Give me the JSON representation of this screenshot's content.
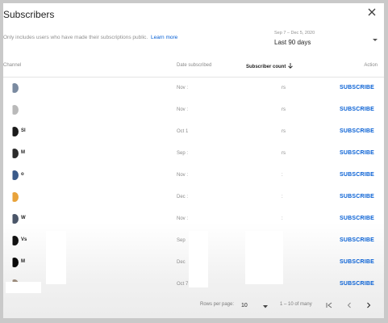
{
  "dialog": {
    "title": "Subscribers",
    "info_text": "Only includes users who have made their subscriptions public.",
    "learn_more": "Learn more",
    "date_range": "Sep 7 – Dec 5, 2020",
    "date_selection": "Last 90 days"
  },
  "table": {
    "columns": {
      "channel": "Channel",
      "date_subscribed": "Date subscribed",
      "subscriber_count": "Subscriber count",
      "action": "Action"
    },
    "rows": [
      {
        "mark": "",
        "date": "Nov :",
        "count": "rs",
        "avatar_color": "#7a8aa0",
        "action": "SUBSCRIBE"
      },
      {
        "mark": "",
        "date": "Nov :",
        "count": "rs",
        "avatar_color": "#b9b9b9",
        "action": "SUBSCRIBE"
      },
      {
        "mark": "Sl",
        "date": "Oct 1",
        "count": "rs",
        "avatar_color": "#1b1b1b",
        "action": "SUBSCRIBE"
      },
      {
        "mark": "M",
        "date": "Sep :",
        "count": "rs",
        "avatar_color": "#2c2c2c",
        "action": "SUBSCRIBE"
      },
      {
        "mark": "o",
        "date": "Nov :",
        "count": ":",
        "avatar_color": "#3a5a8a",
        "action": "SUBSCRIBE"
      },
      {
        "mark": "",
        "date": "Dec :",
        "count": ":",
        "avatar_color": "#e8a23a",
        "action": "SUBSCRIBE"
      },
      {
        "mark": "W",
        "date": "Nov :",
        "count": ":",
        "avatar_color": "#4a5568",
        "action": "SUBSCRIBE"
      },
      {
        "mark": "Vs",
        "date": "Sep",
        "count": ":",
        "avatar_color": "#111111",
        "action": "SUBSCRIBE"
      },
      {
        "mark": "M",
        "date": "Dec",
        "count": "",
        "avatar_color": "#0a0a0a",
        "action": "SUBSCRIBE"
      },
      {
        "mark": "",
        "date": "Oct 7",
        "count": "",
        "avatar_color": "#9a8a7a",
        "action": "SUBSCRIBE"
      }
    ]
  },
  "footer": {
    "rows_per_page_label": "Rows per page:",
    "rows_per_page_value": "10",
    "range_text": "1 – 10 of many"
  }
}
